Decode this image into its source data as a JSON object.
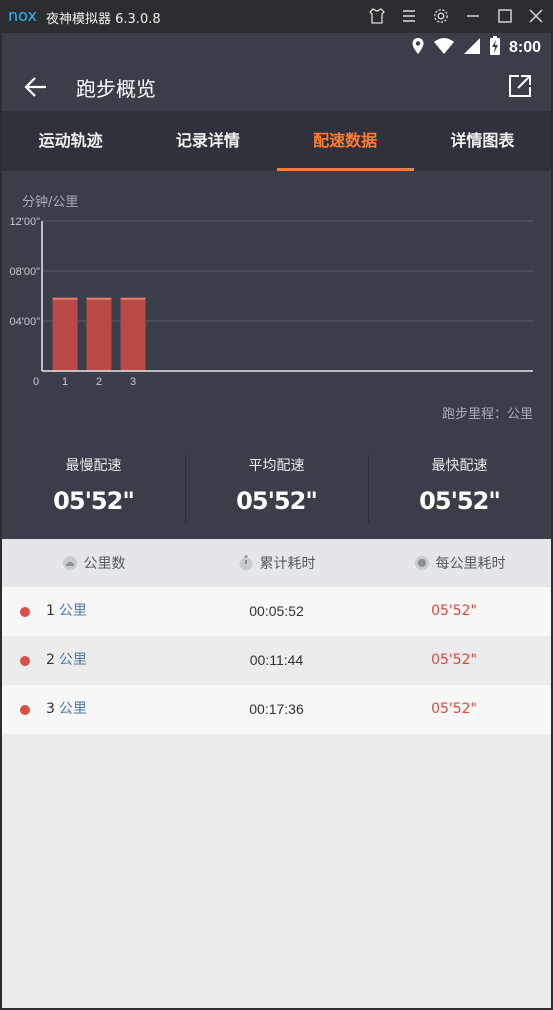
{
  "emulator": {
    "logo": "nox",
    "title": "夜神模拟器 6.3.0.8"
  },
  "status_bar": {
    "time": "8:00"
  },
  "header": {
    "title": "跑步概览"
  },
  "tabs": [
    {
      "label": "运动轨迹",
      "active": false
    },
    {
      "label": "记录详情",
      "active": false
    },
    {
      "label": "配速数据",
      "active": true
    },
    {
      "label": "详情图表",
      "active": false
    }
  ],
  "chart": {
    "y_unit": "分钟/公里",
    "x_unit": "跑步里程：公里",
    "y_ticks": [
      "12'00\"",
      "08'00\"",
      "04'00\""
    ],
    "x_origin": "0",
    "bar_color": "#b94a45"
  },
  "chart_data": {
    "type": "bar",
    "categories": [
      "1",
      "2",
      "3"
    ],
    "values": [
      5.867,
      5.867,
      5.867
    ],
    "xlabel": "跑步里程：公里",
    "ylabel": "分钟/公里",
    "ylim": [
      0,
      12
    ],
    "y_tick_values": [
      4,
      8,
      12
    ],
    "grid": true
  },
  "stats": {
    "slowest_label": "最慢配速",
    "slowest_value": "05'52\"",
    "average_label": "平均配速",
    "average_value": "05'52\"",
    "fastest_label": "最快配速",
    "fastest_value": "05'52\""
  },
  "table": {
    "headers": {
      "km": "公里数",
      "cumulative": "累计耗时",
      "per_km": "每公里耗时"
    },
    "rows": [
      {
        "km": "1",
        "unit": "公里",
        "cumulative": "00:05:52",
        "pace": "05'52\""
      },
      {
        "km": "2",
        "unit": "公里",
        "cumulative": "00:11:44",
        "pace": "05'52\""
      },
      {
        "km": "3",
        "unit": "公里",
        "cumulative": "00:17:36",
        "pace": "05'52\""
      }
    ]
  },
  "colors": {
    "accent": "#ff7a33",
    "header_bg": "#3a3e48",
    "pace_red": "#e0463b",
    "dot_red": "#dd4e44"
  }
}
